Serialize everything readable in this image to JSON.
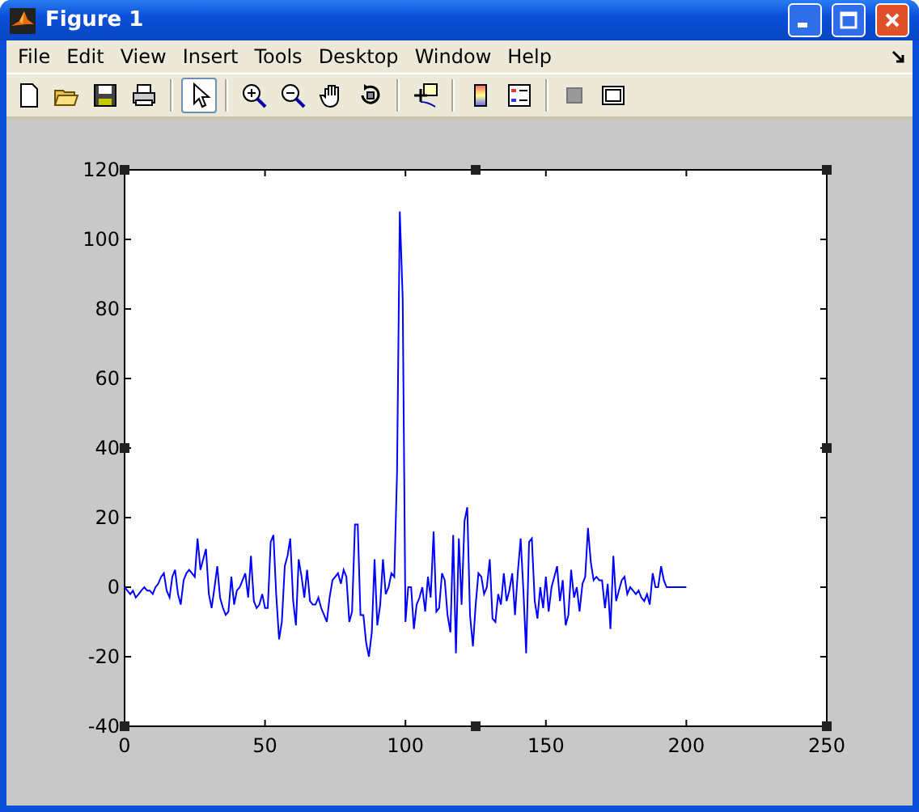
{
  "window": {
    "title": "Figure 1"
  },
  "menu": [
    {
      "label": "File"
    },
    {
      "label": "Edit"
    },
    {
      "label": "View"
    },
    {
      "label": "Insert"
    },
    {
      "label": "Tools"
    },
    {
      "label": "Desktop"
    },
    {
      "label": "Window"
    },
    {
      "label": "Help"
    }
  ],
  "toolbar": [
    {
      "kind": "new",
      "selected": false
    },
    {
      "kind": "open",
      "selected": false
    },
    {
      "kind": "save",
      "selected": false
    },
    {
      "kind": "print",
      "selected": false
    },
    {
      "kind": "sep"
    },
    {
      "kind": "pointer",
      "selected": true
    },
    {
      "kind": "sep"
    },
    {
      "kind": "zoomin",
      "selected": false
    },
    {
      "kind": "zoomout",
      "selected": false
    },
    {
      "kind": "pan",
      "selected": false
    },
    {
      "kind": "rotate",
      "selected": false
    },
    {
      "kind": "sep"
    },
    {
      "kind": "datacursor",
      "selected": false
    },
    {
      "kind": "sep"
    },
    {
      "kind": "colorbar",
      "selected": false
    },
    {
      "kind": "legend",
      "selected": false
    },
    {
      "kind": "sep"
    },
    {
      "kind": "hidetools",
      "selected": false
    },
    {
      "kind": "showtools",
      "selected": false
    }
  ],
  "figure": {
    "chart_data": {
      "type": "line",
      "xlim": [
        0,
        250
      ],
      "ylim": [
        -40,
        120
      ],
      "xticks": [
        0,
        50,
        100,
        150,
        200,
        250
      ],
      "yticks": [
        -40,
        -20,
        0,
        20,
        40,
        60,
        80,
        100,
        120
      ],
      "x": [
        0,
        1,
        2,
        3,
        4,
        5,
        6,
        7,
        8,
        9,
        10,
        11,
        12,
        13,
        14,
        15,
        16,
        17,
        18,
        19,
        20,
        21,
        22,
        23,
        24,
        25,
        26,
        27,
        28,
        29,
        30,
        31,
        32,
        33,
        34,
        35,
        36,
        37,
        38,
        39,
        40,
        41,
        42,
        43,
        44,
        45,
        46,
        47,
        48,
        49,
        50,
        51,
        52,
        53,
        54,
        55,
        56,
        57,
        58,
        59,
        60,
        61,
        62,
        63,
        64,
        65,
        66,
        67,
        68,
        69,
        70,
        71,
        72,
        73,
        74,
        75,
        76,
        77,
        78,
        79,
        80,
        81,
        82,
        83,
        84,
        85,
        86,
        87,
        88,
        89,
        90,
        91,
        92,
        93,
        94,
        95,
        96,
        97,
        98,
        99,
        100,
        101,
        102,
        103,
        104,
        105,
        106,
        107,
        108,
        109,
        110,
        111,
        112,
        113,
        114,
        115,
        116,
        117,
        118,
        119,
        120,
        121,
        122,
        123,
        124,
        125,
        126,
        127,
        128,
        129,
        130,
        131,
        132,
        133,
        134,
        135,
        136,
        137,
        138,
        139,
        140,
        141,
        142,
        143,
        144,
        145,
        146,
        147,
        148,
        149,
        150,
        151,
        152,
        153,
        154,
        155,
        156,
        157,
        158,
        159,
        160,
        161,
        162,
        163,
        164,
        165,
        166,
        167,
        168,
        169,
        170,
        171,
        172,
        173,
        174,
        175,
        176,
        177,
        178,
        179,
        180,
        181,
        182,
        183,
        184,
        185,
        186,
        187,
        188,
        189,
        190,
        191,
        192,
        193,
        194,
        195,
        196,
        197,
        198,
        199,
        200
      ],
      "series": [
        {
          "color": "#0000ff",
          "values": [
            0,
            -1,
            -2,
            -1,
            -3,
            -2,
            -1,
            0,
            -1,
            -1,
            -2,
            0,
            1,
            3,
            4,
            -1,
            -3,
            3,
            5,
            -2,
            -5,
            2,
            4,
            5,
            4,
            3,
            14,
            5,
            8,
            11,
            -2,
            -6,
            0,
            6,
            -3,
            -6,
            -8,
            -7,
            3,
            -5,
            -1,
            0,
            2,
            4,
            -3,
            9,
            -4,
            -6,
            -5,
            -2,
            -6,
            -6,
            13,
            15,
            -2,
            -15,
            -10,
            6,
            9,
            14,
            -4,
            -11,
            8,
            3,
            -3,
            5,
            -4,
            -5,
            -5,
            -3,
            -6,
            -8,
            -10,
            -3,
            2,
            3,
            4,
            1,
            5,
            3,
            -10,
            -7,
            18,
            18,
            -8,
            -8,
            -16,
            -20,
            -13,
            8,
            -11,
            -5,
            8,
            -2,
            0,
            4,
            3,
            33,
            108,
            83,
            -10,
            0,
            0,
            -12,
            -5,
            -3,
            0,
            -7,
            3,
            -3,
            16,
            -7,
            -6,
            4,
            2,
            -8,
            -13,
            15,
            -19,
            14,
            -5,
            19,
            23,
            -8,
            -17,
            -5,
            4,
            3,
            -2,
            0,
            8,
            -9,
            -10,
            -2,
            -5,
            4,
            -4,
            -1,
            4,
            -8,
            4,
            14,
            -1,
            -19,
            13,
            14,
            -4,
            -9,
            0,
            -6,
            3,
            -7,
            0,
            3,
            6,
            -4,
            2,
            -11,
            -8,
            5,
            -3,
            0,
            -7,
            1,
            3,
            17,
            7,
            2,
            3,
            2,
            2,
            -6,
            1,
            -12,
            9,
            -4,
            -1,
            2,
            3,
            -2,
            0,
            -1,
            -2,
            -1,
            -3,
            -4,
            -2,
            -5,
            4,
            0,
            0,
            6,
            2,
            0,
            0,
            0,
            0,
            0,
            0,
            0,
            0
          ]
        }
      ]
    }
  }
}
